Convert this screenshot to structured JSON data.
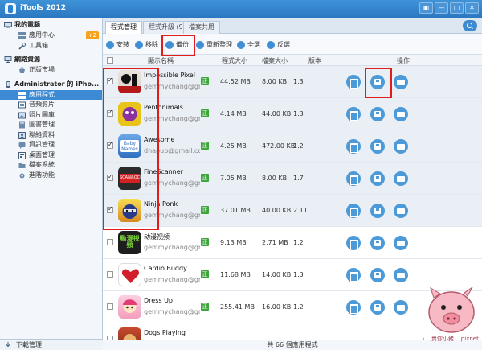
{
  "window": {
    "title": "iTools 2012",
    "controls": [
      "▣",
      "—",
      "□",
      "✕"
    ]
  },
  "sidebar": {
    "sections": [
      {
        "label": "我的電腦",
        "items": [
          {
            "label": "應用中心",
            "badge": "+2"
          },
          {
            "label": "工具箱"
          }
        ]
      },
      {
        "label": "網路資源",
        "items": [
          {
            "label": "正版市場"
          }
        ]
      },
      {
        "label": "Administrator 的 iPho...",
        "items": [
          {
            "label": "應用程式",
            "active": true
          },
          {
            "label": "音頻影片"
          },
          {
            "label": "照片圖庫"
          },
          {
            "label": "圖書管理"
          },
          {
            "label": "聯絡資料"
          },
          {
            "label": "資訊管理"
          },
          {
            "label": "桌面管理"
          },
          {
            "label": "檔案系統"
          },
          {
            "label": "進階功能"
          }
        ]
      }
    ],
    "bottom": "下載管理"
  },
  "tabs": [
    "程式管理",
    "程式升級 (9)",
    "檔案共用"
  ],
  "toolbar": [
    "安裝",
    "移除",
    "備份",
    "重新整理",
    "全選",
    "反選"
  ],
  "columns": {
    "name": "顯示名稱",
    "size": "程式大小",
    "doc_size": "檔案大小",
    "version": "版本",
    "actions": "操作"
  },
  "apps": [
    {
      "name": "Impossible Pixel",
      "dev": "gemmychang@gm...",
      "size": "44.52 MB",
      "doc": "8.00 KB",
      "version": "1.3",
      "checked": true
    },
    {
      "name": "Pentonimals",
      "dev": "gemmychang@gm...",
      "size": "4.14 MB",
      "doc": "44.00 KB",
      "version": "1.3",
      "checked": true
    },
    {
      "name": "Awesome",
      "dev": "dnapub@gmail.com",
      "size": "4.25 MB",
      "doc": "472.00 KB",
      "version": "1.2",
      "checked": true
    },
    {
      "name": "FineScanner",
      "dev": "gemmychang@gm...",
      "size": "7.05 MB",
      "doc": "8.00 KB",
      "version": "1.7",
      "checked": true
    },
    {
      "name": "Ninja Ponk",
      "dev": "gemmychang@gm...",
      "size": "37.01 MB",
      "doc": "40.00 KB",
      "version": "2.11",
      "checked": true
    },
    {
      "name": "动漫视频",
      "dev": "gemmychang@gm...",
      "size": "9.13 MB",
      "doc": "2.71 MB",
      "version": "1.2",
      "checked": false
    },
    {
      "name": "Cardio Buddy",
      "dev": "gemmychang@gm...",
      "size": "11.68 MB",
      "doc": "14.00 KB",
      "version": "1.3",
      "checked": false
    },
    {
      "name": "Dress Up",
      "dev": "gemmychang@gm...",
      "size": "255.41 MB",
      "doc": "16.00 KB",
      "version": "1.2",
      "checked": false
    },
    {
      "name": "Dogs Playing",
      "dev": "",
      "size": "",
      "doc": "",
      "version": "",
      "checked": false
    }
  ],
  "icon_labels": {
    "awesome": "Baby Names",
    "finescanner": "SCAN&OCR",
    "anime": "動漫視頻"
  },
  "status": "共 66 個應用程式",
  "watermark": "mon... 賣你小豬 ...pixnet.net"
}
